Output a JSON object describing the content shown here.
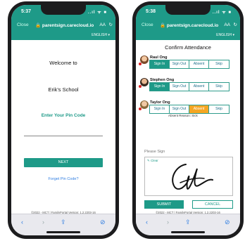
{
  "left_phone": {
    "status": {
      "time": "5:37",
      "signal": "..ıl ᯤ ■"
    },
    "browser": {
      "close": "Close",
      "url": "🔒 parentsign.carecloud.io",
      "aa": "AA",
      "reload": "↻"
    },
    "appbar": {
      "language": "ENGLISH ▾"
    },
    "welcome": "Welcome to",
    "school": "Erik's School",
    "pin_label": "Enter Your Pin Code",
    "pin_value": "",
    "next_label": "NEXT",
    "forgot_label": "Forget Pin Code?",
    "footer": "©2022 - MCT | FamilyPortal  Version: 1.2.2203-16",
    "toolbar": {
      "back": "‹",
      "forward": "›",
      "share": "⇪",
      "compass": "⊘"
    }
  },
  "right_phone": {
    "status": {
      "time": "5:38",
      "signal": "..ıl ᯤ ■"
    },
    "browser": {
      "close": "Close",
      "url": "🔒 parentsign.carecloud.io",
      "aa": "AA",
      "reload": "↻"
    },
    "appbar": {
      "language": "ENGLISH ▾"
    },
    "title": "Confirm Attendance",
    "options": [
      "Sign In",
      "Sign Out",
      "Absent",
      "Skip"
    ],
    "people": [
      {
        "name": "Raul Ong",
        "selected": "Sign In"
      },
      {
        "name": "Stephen Ong",
        "selected": "Sign In"
      },
      {
        "name": "Taylor Ong",
        "selected": "Absent",
        "reason": "Absent Reason:  Sick"
      }
    ],
    "please_sign": "Please Sign",
    "clear_label": "✎ Clear",
    "submit_label": "SUBMIT",
    "cancel_label": "CANCEL",
    "footer": "©2022 - MCT | FamilyPortal  Version: 1.2.2203-16",
    "toolbar": {
      "back": "‹",
      "forward": "›",
      "share": "⇪",
      "compass": "⊘"
    }
  },
  "colors": {
    "accent": "#1e9a88",
    "absent": "#f5a623",
    "link": "#2f7de1"
  }
}
